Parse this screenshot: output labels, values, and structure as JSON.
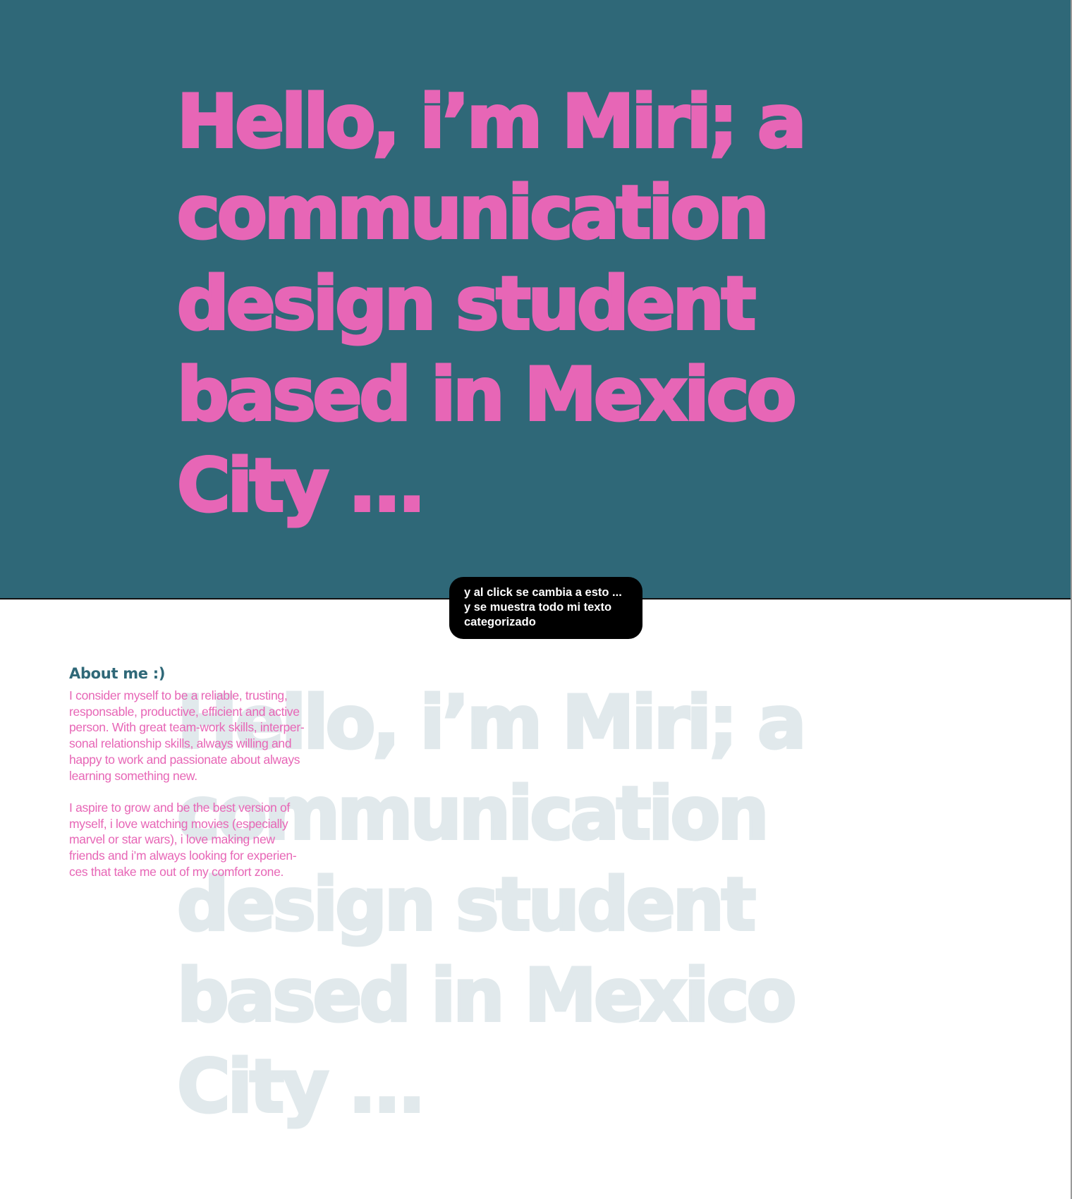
{
  "colors": {
    "hero_background": "#2f6878",
    "headline_pink": "#e766b6",
    "ghost_headline": "#e1e9ec",
    "note_background": "#000000",
    "about_title": "#2f6878",
    "about_text": "#e766b6"
  },
  "hero": {
    "headline": "Hello, i’m Miri; a\ncommunication\ndesign student\nbased in Mexico\nCity ..."
  },
  "note": {
    "text": "y al click se cambia a esto ...\ny se muestra todo mi texto\ncategorizado"
  },
  "about": {
    "title": "About me :)",
    "paragraphs": [
      "I consider myself to be a reliable, trusting,\nresponsable, productive, efficient and active\nperson. With great team-work skills, interper-\nsonal relationship skills, always willing and\nhappy to work and passionate about always\nlearning something new.",
      "I aspire to grow and be the best version of\nmyself, i love watching movies (especially\nmarvel or star wars), i love making new\nfriends and i’m always looking for experien-\nces that take me out of my comfort zone."
    ]
  },
  "ghost": {
    "headline": "Hello, i’m Miri; a\ncommunication\ndesign student\nbased in Mexico\nCity ..."
  }
}
